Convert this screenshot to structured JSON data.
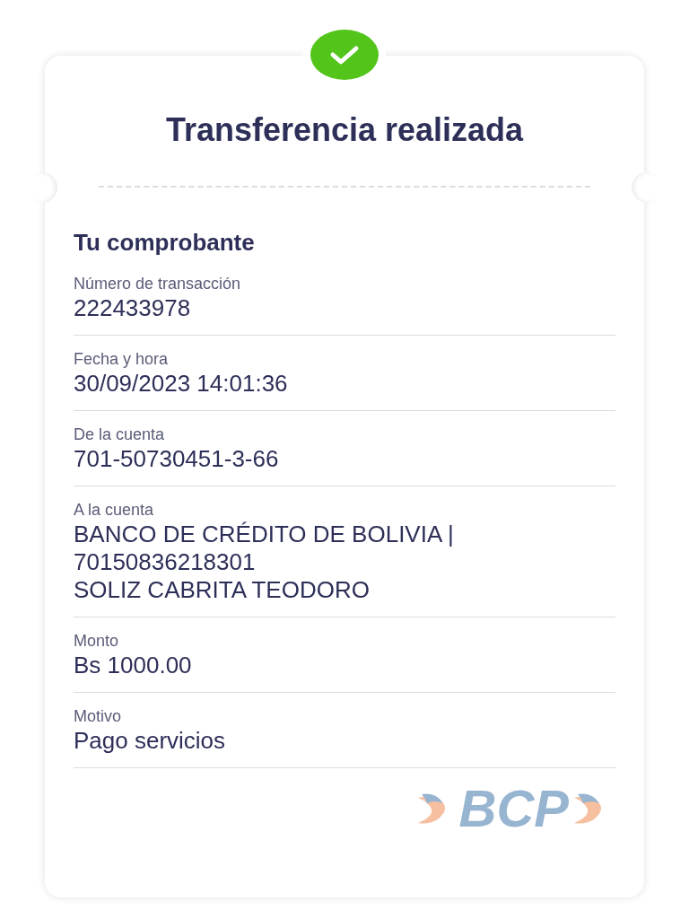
{
  "title": "Transferencia realizada",
  "section_title": "Tu comprobante",
  "fields": [
    {
      "label": "Número de transacción",
      "value": [
        "222433978"
      ]
    },
    {
      "label": "Fecha y hora",
      "value": [
        "30/09/2023 14:01:36"
      ]
    },
    {
      "label": "De la cuenta",
      "value": [
        "701-50730451-3-66"
      ]
    },
    {
      "label": "A la cuenta",
      "value": [
        "BANCO DE CRÉDITO DE BOLIVIA |",
        "70150836218301",
        "SOLIZ CABRITA TEODORO"
      ]
    },
    {
      "label": "Monto",
      "value": [
        "Bs 1000.00"
      ]
    },
    {
      "label": "Motivo",
      "value": [
        "Pago servicios"
      ]
    }
  ],
  "logo_text": "BCP"
}
